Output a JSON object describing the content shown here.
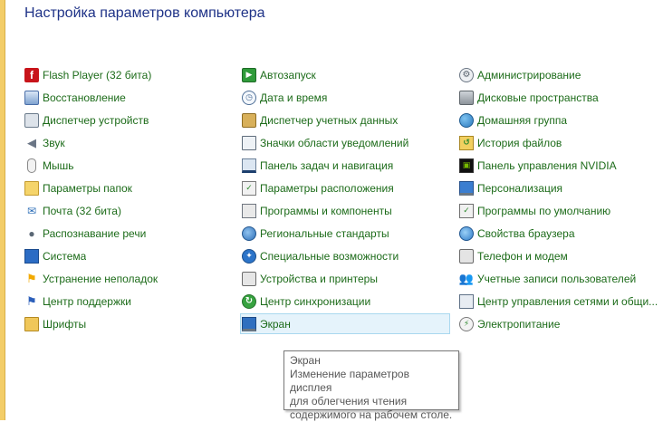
{
  "page": {
    "title": "Настройка параметров компьютера"
  },
  "colors": {
    "link": "#1c6b19",
    "title": "#1e3287",
    "accent_strip": "#f3cd68",
    "highlight_bg": "#e5f3fb"
  },
  "items": {
    "col1": [
      {
        "label": "Flash Player (32 бита)",
        "icon": "flash-icon",
        "glyph": "f"
      },
      {
        "label": "Восстановление",
        "icon": "recovery-icon",
        "glyph": ""
      },
      {
        "label": "Диспетчер устройств",
        "icon": "device-manager-icon",
        "glyph": ""
      },
      {
        "label": "Звук",
        "icon": "speaker-icon",
        "glyph": "◀"
      },
      {
        "label": "Мышь",
        "icon": "mouse-icon",
        "glyph": ""
      },
      {
        "label": "Параметры папок",
        "icon": "folder-icon",
        "glyph": ""
      },
      {
        "label": "Почта (32 бита)",
        "icon": "mail-icon",
        "glyph": "✉"
      },
      {
        "label": "Распознавание речи",
        "icon": "microphone-icon",
        "glyph": "●"
      },
      {
        "label": "Система",
        "icon": "system-icon",
        "glyph": ""
      },
      {
        "label": "Устранение неполадок",
        "icon": "troubleshoot-icon",
        "glyph": "⚑"
      },
      {
        "label": "Центр поддержки",
        "icon": "action-center-flag-icon",
        "glyph": "⚑"
      },
      {
        "label": "Шрифты",
        "icon": "fonts-folder-icon",
        "glyph": ""
      }
    ],
    "col2": [
      {
        "label": "Автозапуск",
        "icon": "autoplay-icon",
        "glyph": "▶"
      },
      {
        "label": "Дата и время",
        "icon": "clock-icon",
        "glyph": "◷"
      },
      {
        "label": "Диспетчер учетных данных",
        "icon": "credential-safe-icon",
        "glyph": ""
      },
      {
        "label": "Значки области уведомлений",
        "icon": "notification-icons-icon",
        "glyph": ""
      },
      {
        "label": "Панель задач и навигация",
        "icon": "taskbar-icon",
        "glyph": ""
      },
      {
        "label": "Параметры расположения",
        "icon": "location-icon",
        "glyph": "✓"
      },
      {
        "label": "Программы и компоненты",
        "icon": "programs-icon",
        "glyph": ""
      },
      {
        "label": "Региональные стандарты",
        "icon": "globe-icon",
        "glyph": ""
      },
      {
        "label": "Специальные возможности",
        "icon": "accessibility-icon",
        "glyph": "✦"
      },
      {
        "label": "Устройства и принтеры",
        "icon": "printer-icon",
        "glyph": ""
      },
      {
        "label": "Центр синхронизации",
        "icon": "sync-icon",
        "glyph": "↻"
      },
      {
        "label": "Экран",
        "icon": "display-icon",
        "glyph": ""
      }
    ],
    "col3": [
      {
        "label": "Администрирование",
        "icon": "admin-tools-icon",
        "glyph": "⚙"
      },
      {
        "label": "Дисковые пространства",
        "icon": "storage-spaces-icon",
        "glyph": ""
      },
      {
        "label": "Домашняя группа",
        "icon": "homegroup-icon",
        "glyph": ""
      },
      {
        "label": "История файлов",
        "icon": "file-history-icon",
        "glyph": "↺"
      },
      {
        "label": "Панель управления NVIDIA",
        "icon": "nvidia-icon",
        "glyph": "▣"
      },
      {
        "label": "Персонализация",
        "icon": "personalization-icon",
        "glyph": ""
      },
      {
        "label": "Программы по умолчанию",
        "icon": "default-programs-icon",
        "glyph": "✓"
      },
      {
        "label": "Свойства браузера",
        "icon": "browser-globe-icon",
        "glyph": ""
      },
      {
        "label": "Телефон и модем",
        "icon": "phone-modem-icon",
        "glyph": ""
      },
      {
        "label": "Учетные записи пользователей",
        "icon": "users-icon",
        "glyph": "👥"
      },
      {
        "label": "Центр управления сетями и общи...",
        "icon": "network-center-icon",
        "glyph": ""
      },
      {
        "label": "Электропитание",
        "icon": "power-options-icon",
        "glyph": "⚡"
      }
    ]
  },
  "hovered_item": "Экран",
  "tooltip": {
    "title": "Экран",
    "description": "Изменение параметров дисплея\nдля облегчения чтения\nсодержимого на рабочем столе."
  }
}
